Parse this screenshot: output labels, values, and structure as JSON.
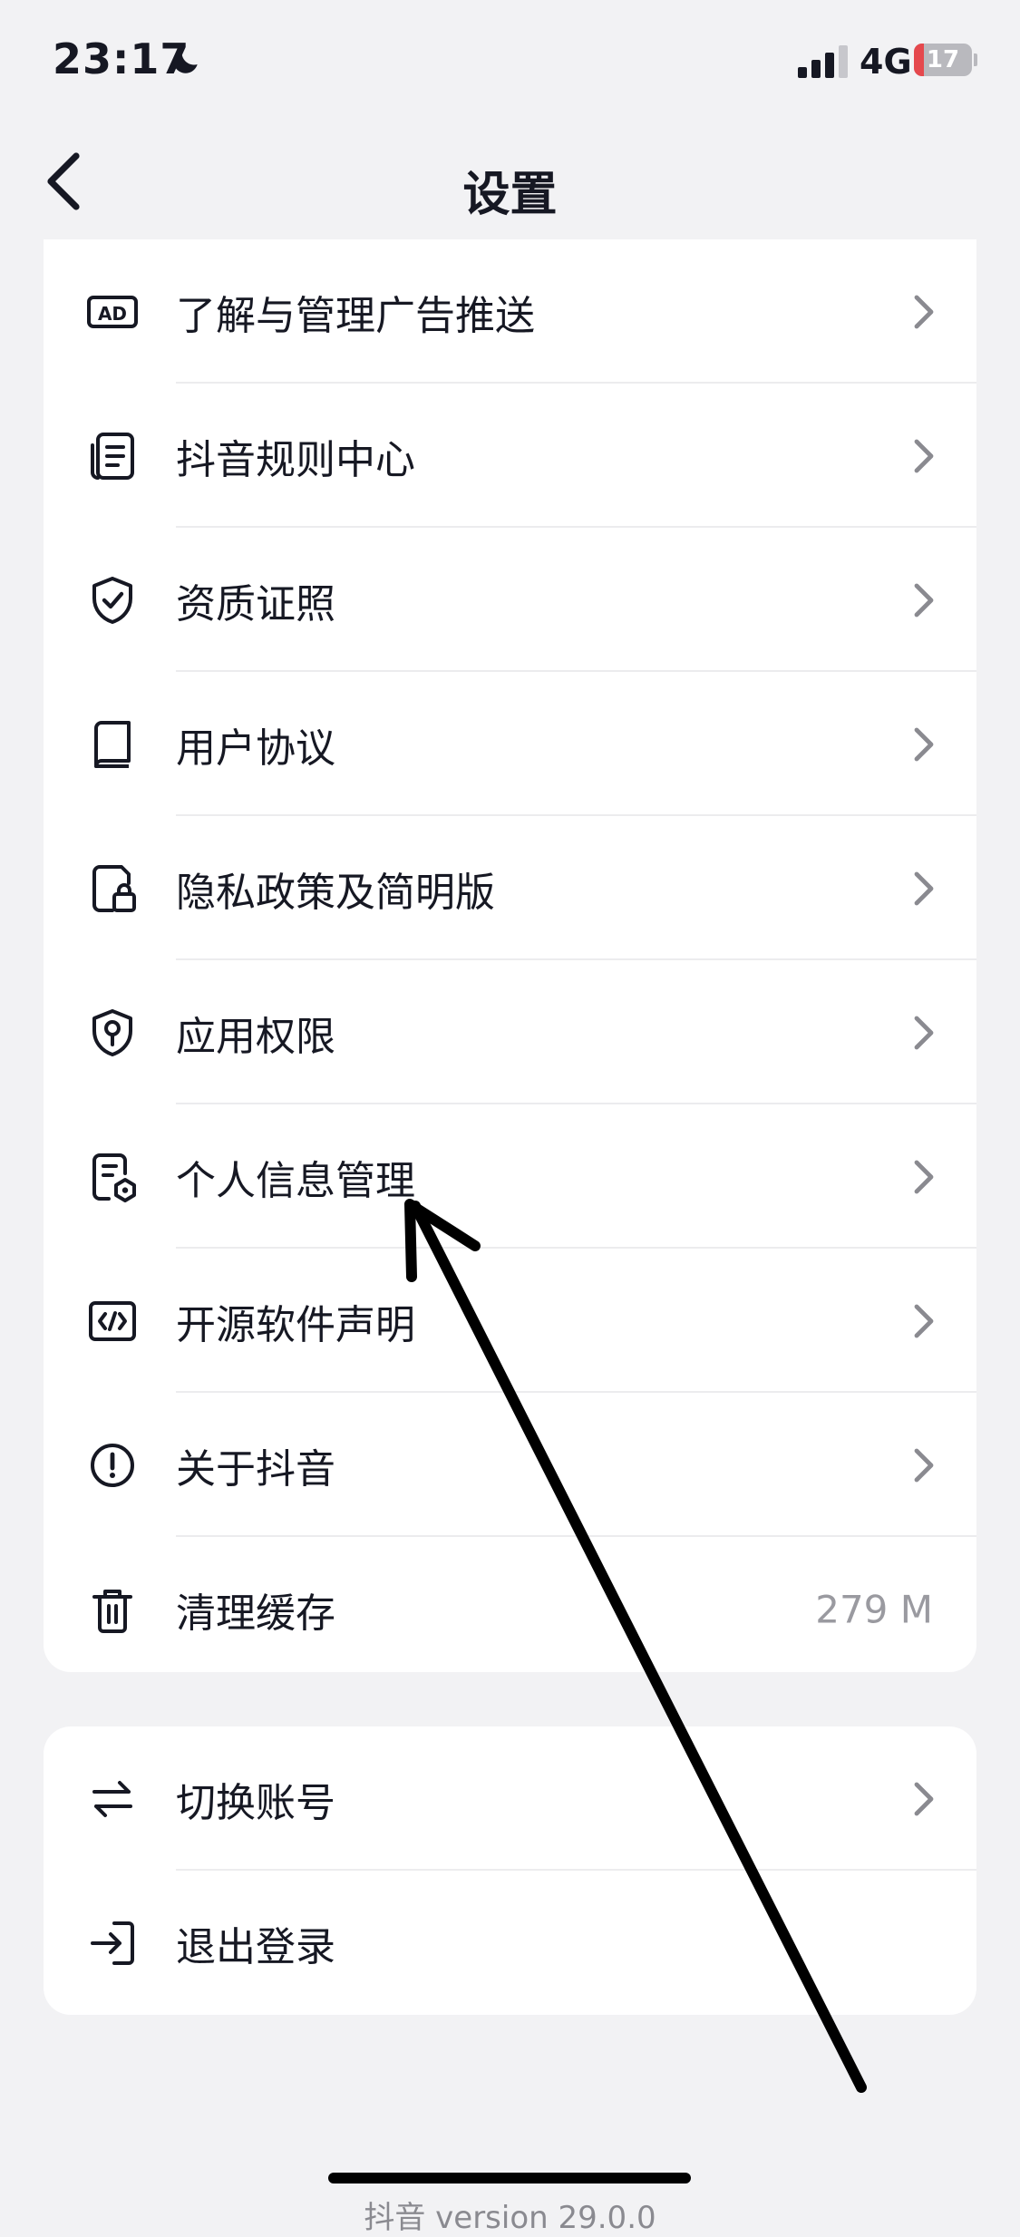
{
  "status_bar": {
    "time": "23:17",
    "network": "4G",
    "battery": "17",
    "battery_level": 0.17,
    "icons": [
      "moon-icon",
      "signal-icon",
      "battery-icon"
    ]
  },
  "header": {
    "title": "设置",
    "back_icon": "chevron-left-icon"
  },
  "settings_group_1": [
    {
      "label": "了解与管理广告推送",
      "icon": "ad-icon"
    },
    {
      "label": "抖音规则中心",
      "icon": "document-list-icon"
    },
    {
      "label": "资质证照",
      "icon": "shield-check-icon"
    },
    {
      "label": "用户协议",
      "icon": "book-icon"
    },
    {
      "label": "隐私政策及简明版",
      "icon": "document-lock-icon"
    },
    {
      "label": "应用权限",
      "icon": "shield-key-icon"
    },
    {
      "label": "个人信息管理",
      "icon": "personal-info-icon"
    },
    {
      "label": "开源软件声明",
      "icon": "code-icon"
    },
    {
      "label": "关于抖音",
      "icon": "info-circle-icon"
    },
    {
      "label": "清理缓存",
      "icon": "trash-icon",
      "value": "279 M"
    }
  ],
  "settings_group_2": [
    {
      "label": "切换账号",
      "icon": "switch-arrows-icon"
    },
    {
      "label": "退出登录",
      "icon": "logout-icon"
    }
  ],
  "footer": {
    "text": "抖音 version 29.0.0"
  },
  "colors": {
    "background": "#f2f2f4",
    "card": "#ffffff",
    "text": "#161823",
    "secondary_text": "#9a9aa0",
    "battery_low": "#e5484d",
    "annotation_arrow": "#000000"
  }
}
